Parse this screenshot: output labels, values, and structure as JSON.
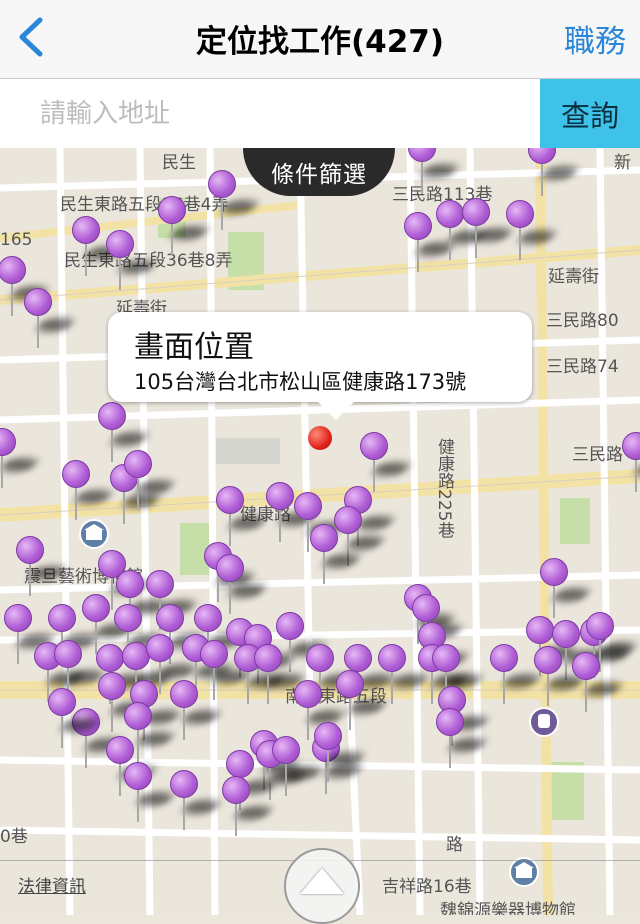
{
  "nav": {
    "title": "定位找工作(427)",
    "right_label": "職務"
  },
  "search": {
    "placeholder": "請輸入地址",
    "value": "",
    "button_label": "查詢"
  },
  "filter": {
    "label": "條件篩選"
  },
  "callout": {
    "title": "畫面位置",
    "address": "105台灣台北市松山區健康路173號"
  },
  "legal_label": "法律資訊",
  "map_labels": {
    "l1": "民生東路五段36巷4弄",
    "l2": "民生東路五段36巷8弄",
    "l3": "三民路113巷",
    "l4": "延壽街",
    "l5": "三民路80",
    "l6": "三民路74",
    "l7": "三民路",
    "l8": "健康路225巷",
    "l9": "健康路",
    "l10": "震旦藝術博物館",
    "l11": "南京東路五段",
    "l12": "吉祥路16巷",
    "l13": "魏錦源樂器博物館",
    "l14": "0巷",
    "l15": "165",
    "l16": "延壽街",
    "l17": "路",
    "l18": "民生",
    "l19": "新"
  },
  "colors": {
    "nav_accent": "#2a86d8",
    "search_button": "#3ec2ea",
    "pin": "#b15fd6",
    "current_location_pin": "#e0231a"
  }
}
